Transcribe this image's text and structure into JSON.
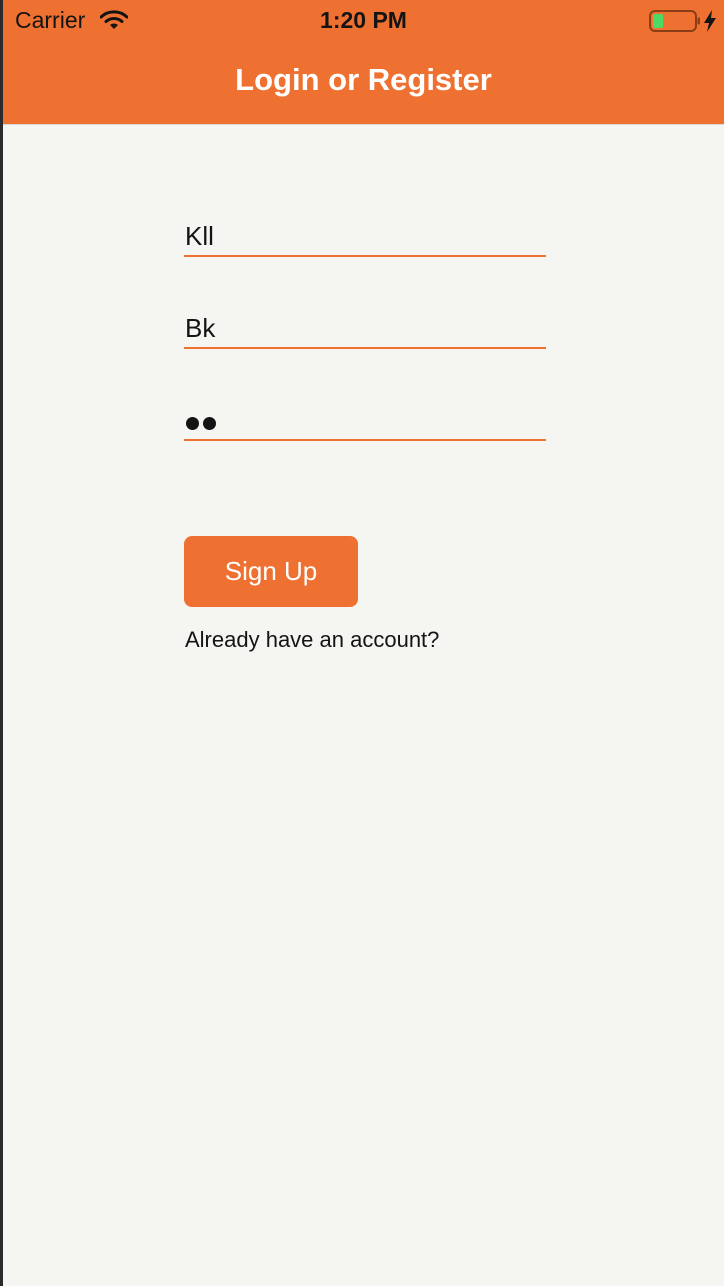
{
  "status_bar": {
    "carrier": "Carrier",
    "time": "1:20 PM",
    "battery_color": "#4cd964"
  },
  "header": {
    "title": "Login or Register",
    "color": "#ef7131"
  },
  "form": {
    "username_value": "Kll",
    "name_value": "Bk",
    "password_masked": "••",
    "signup_label": "Sign Up",
    "login_link": "Already have an account?"
  }
}
